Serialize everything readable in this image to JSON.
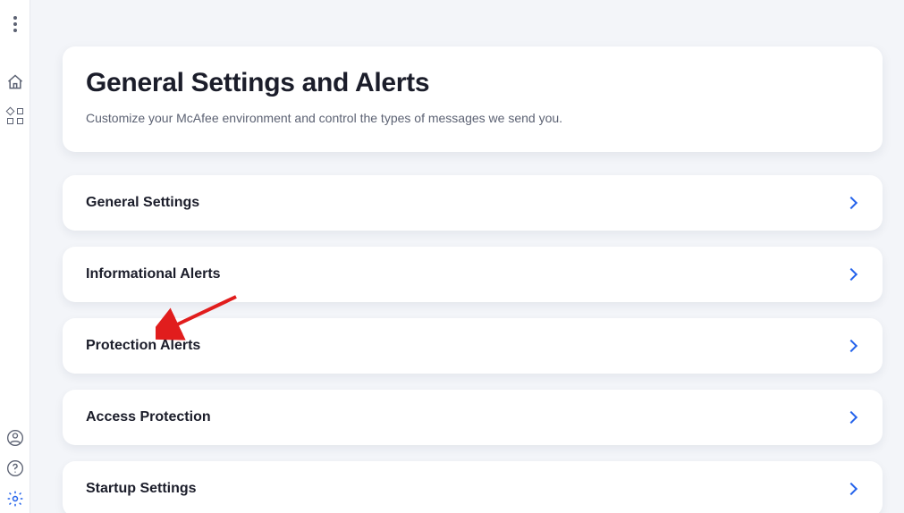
{
  "header": {
    "title": "General Settings and Alerts",
    "subtitle": "Customize your McAfee environment and control the types of messages we send you."
  },
  "rows": [
    {
      "label": "General Settings"
    },
    {
      "label": "Informational Alerts"
    },
    {
      "label": "Protection Alerts"
    },
    {
      "label": "Access Protection"
    },
    {
      "label": "Startup Settings"
    }
  ]
}
